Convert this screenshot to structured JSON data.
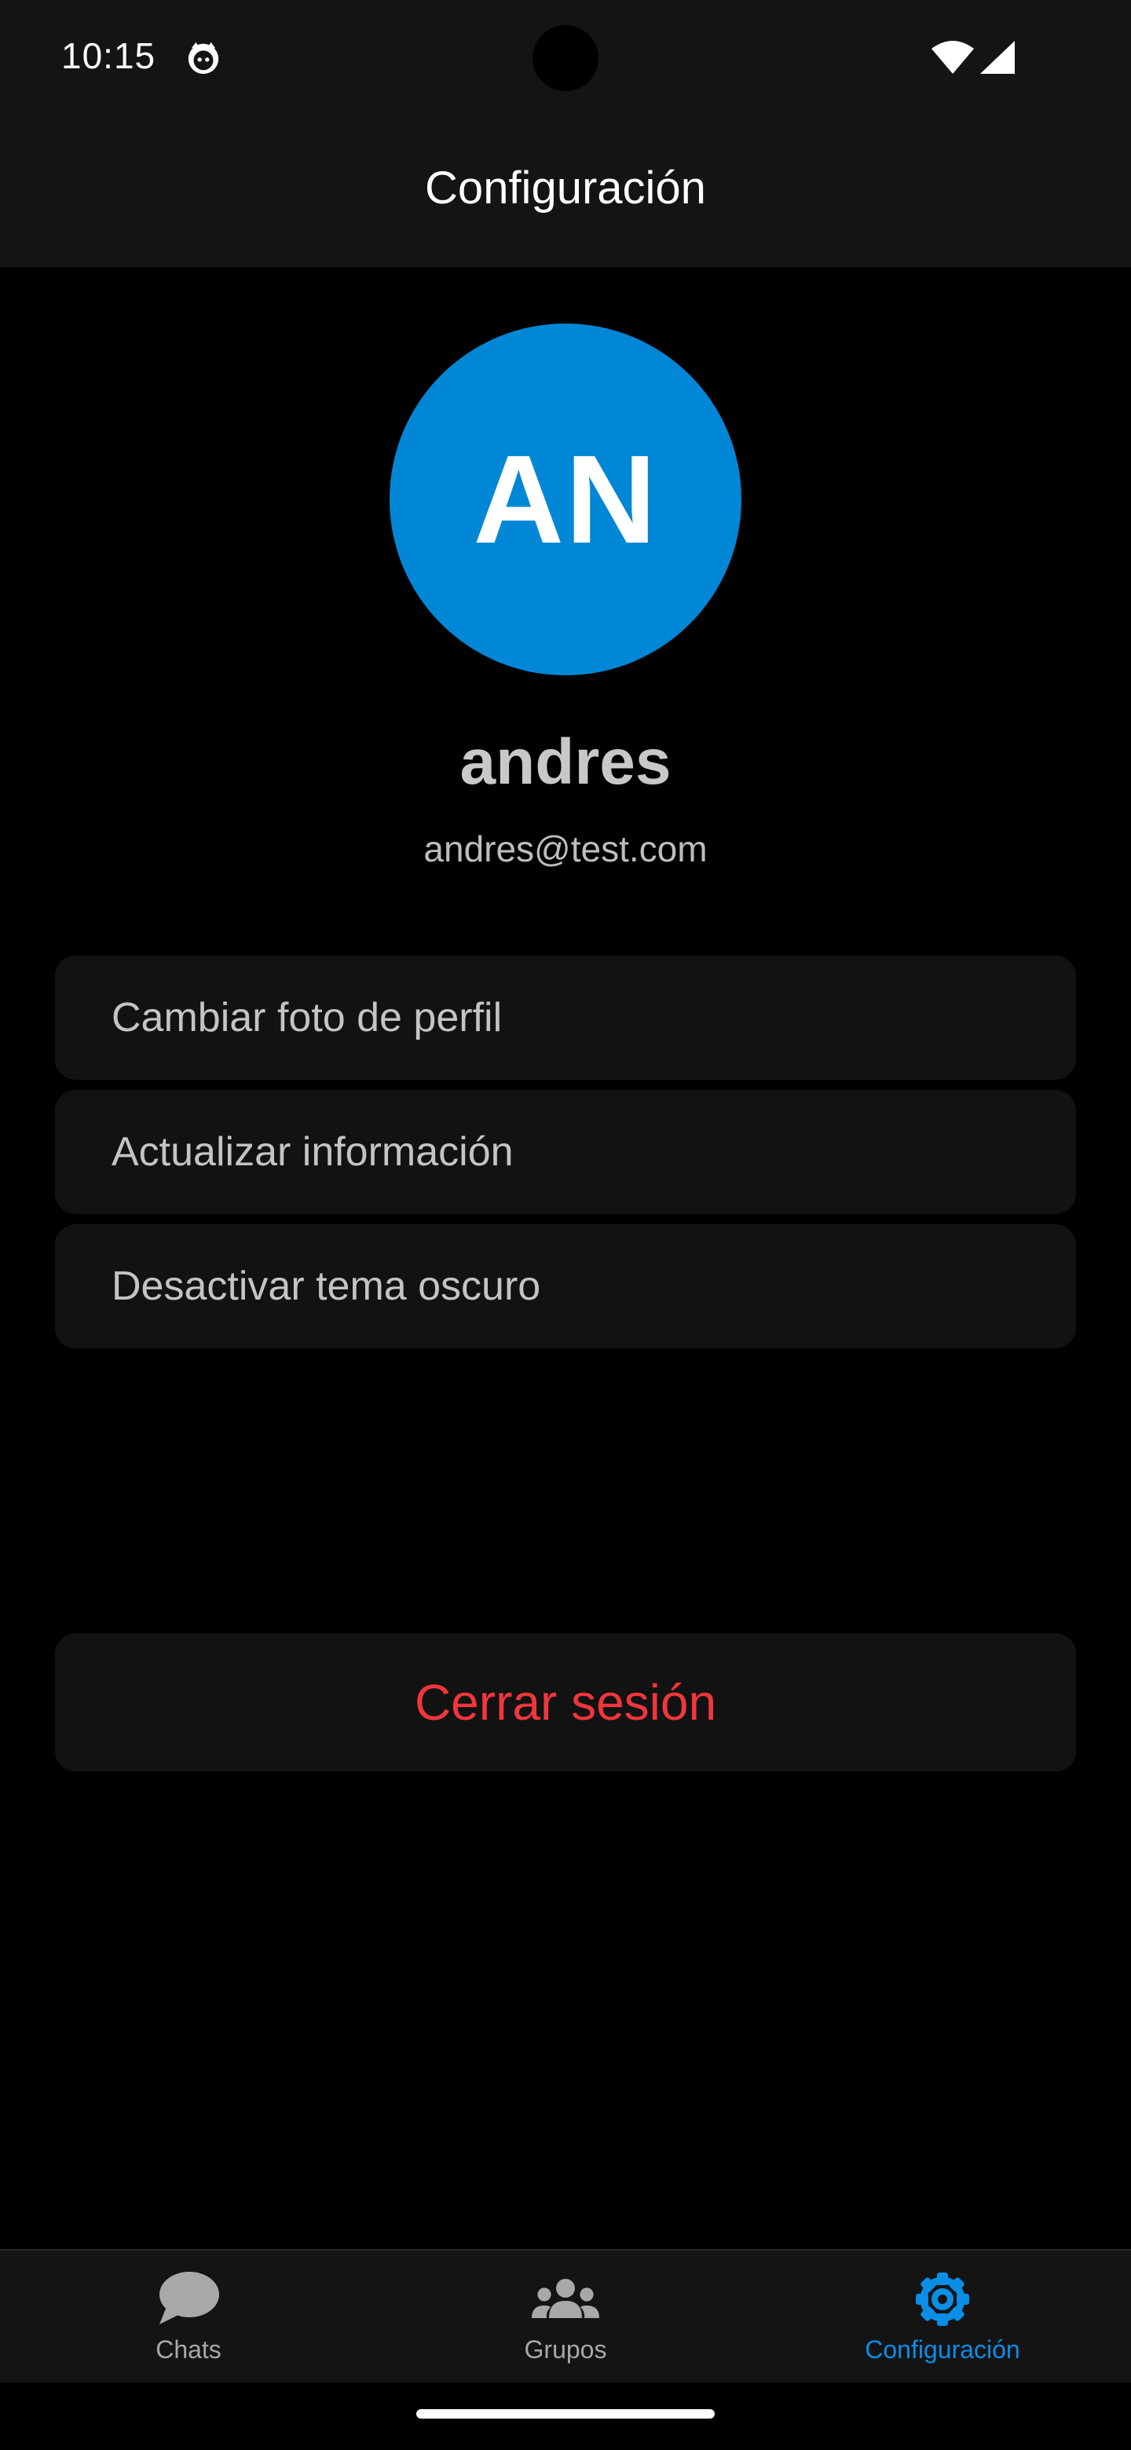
{
  "status_bar": {
    "time": "10:15",
    "icons": [
      "app-notification-icon",
      "wifi-icon",
      "cell-signal-icon"
    ]
  },
  "app_bar": {
    "title": "Configuración"
  },
  "profile": {
    "initials": "AN",
    "name": "andres",
    "email": "andres@test.com",
    "avatar_color": "#0287d6"
  },
  "options": [
    {
      "label": "Cambiar foto de perfil"
    },
    {
      "label": "Actualizar información"
    },
    {
      "label": "Desactivar tema oscuro"
    }
  ],
  "logout": {
    "label": "Cerrar sesión",
    "color": "#f0363c"
  },
  "bottom_nav": {
    "items": [
      {
        "label": "Chats",
        "icon": "chat-bubble-icon",
        "active": false
      },
      {
        "label": "Grupos",
        "icon": "people-group-icon",
        "active": false
      },
      {
        "label": "Configuración",
        "icon": "gear-icon",
        "active": true
      }
    ],
    "active_color": "#0a8ee6",
    "inactive_color": "#a8a8a8"
  }
}
